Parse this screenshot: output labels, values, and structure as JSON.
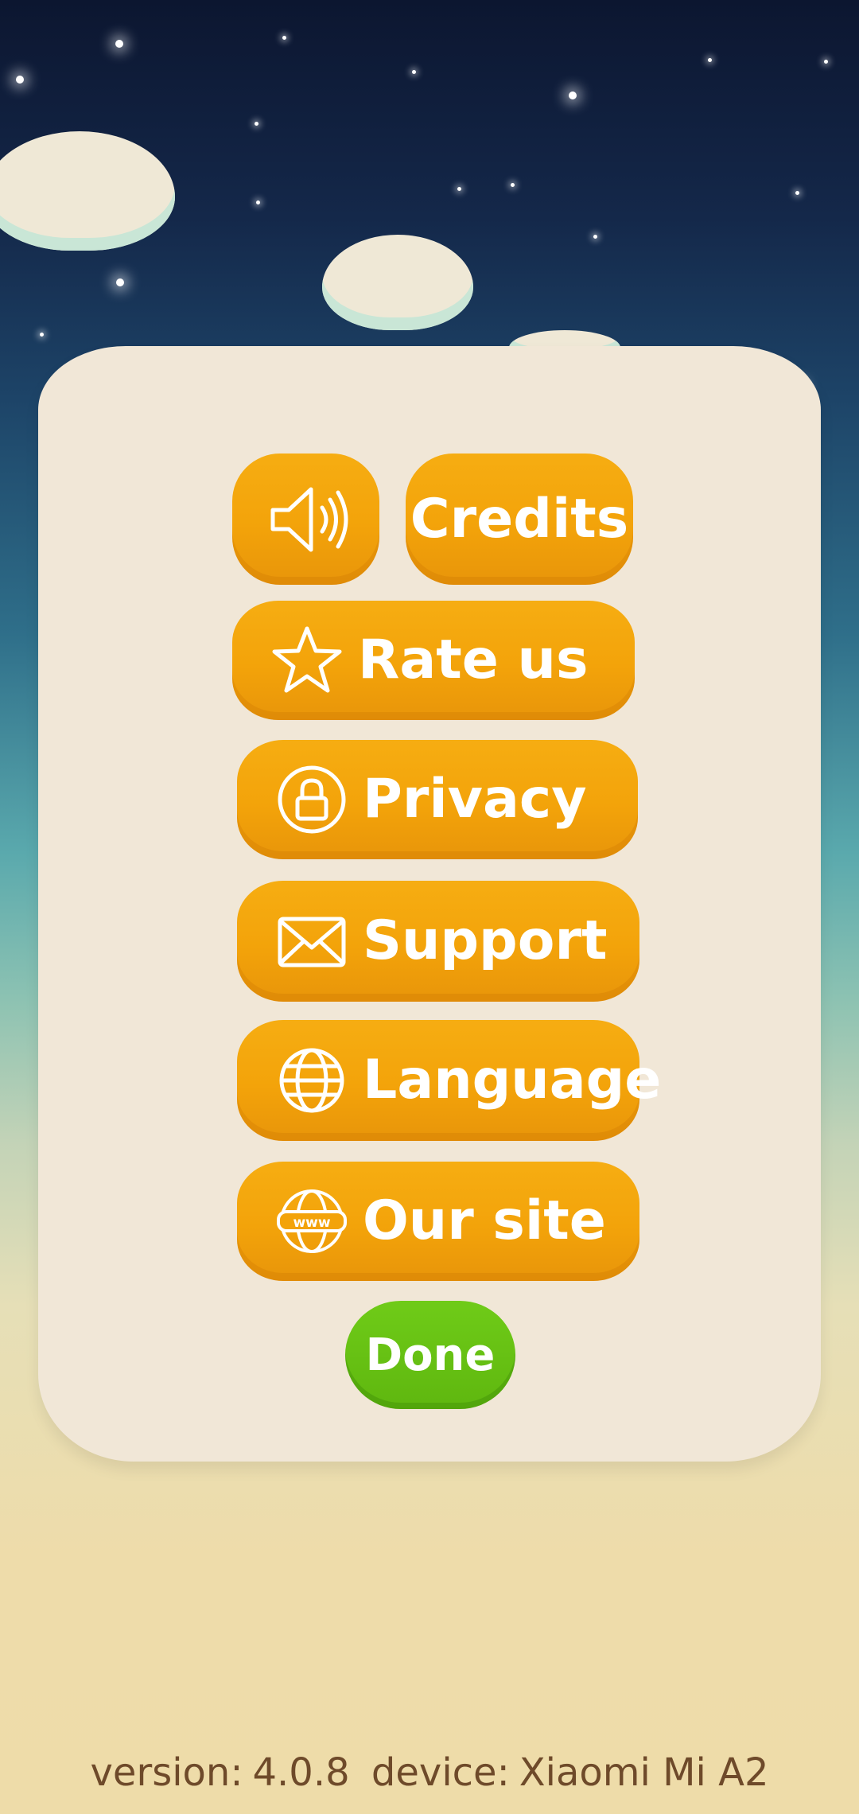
{
  "buttons": {
    "sound": {
      "icon": "speaker-sound-icon"
    },
    "credits": {
      "label": "Credits"
    },
    "rate": {
      "label": "Rate us",
      "icon": "star-icon"
    },
    "privacy": {
      "label": "Privacy",
      "icon": "lock-icon"
    },
    "support": {
      "label": "Support",
      "icon": "envelope-icon"
    },
    "language": {
      "label": "Language",
      "icon": "globe-icon"
    },
    "site": {
      "label": "Our site",
      "icon": "www-globe-icon"
    },
    "done": {
      "label": "Done"
    }
  },
  "footer": {
    "version_label": "version:",
    "version_value": "4.0.8",
    "device_label": "device:",
    "device_value": "Xiaomi Mi A2"
  },
  "colors": {
    "button_orange": "#f3a30a",
    "button_green": "#5fb70f",
    "panel": "#f1e7d7",
    "footer_text": "#6e4a2a"
  }
}
